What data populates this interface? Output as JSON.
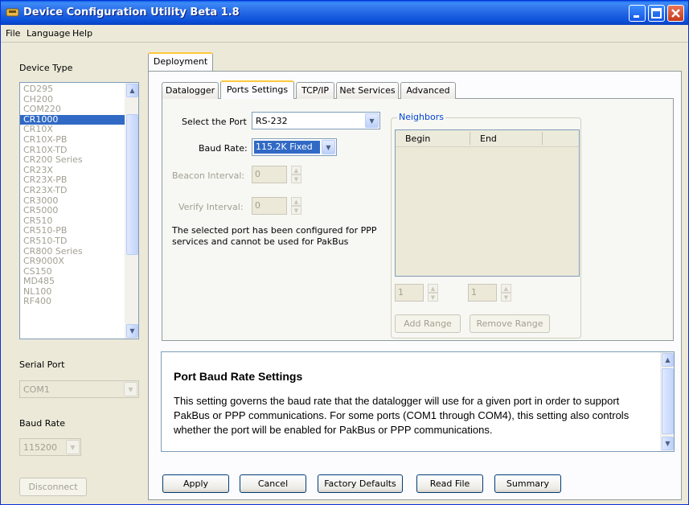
{
  "window": {
    "title": "Device Configuration Utility Beta 1.8"
  },
  "menu": [
    "File",
    "Language",
    "Help"
  ],
  "sidebar": {
    "device_type_label": "Device Type",
    "devices": [
      "CD295",
      "CH200",
      "COM220",
      "CR1000",
      "CR10X",
      "CR10X-PB",
      "CR10X-TD",
      "CR200 Series",
      "CR23X",
      "CR23X-PB",
      "CR23X-TD",
      "CR3000",
      "CR5000",
      "CR510",
      "CR510-PB",
      "CR510-TD",
      "CR800 Series",
      "CR9000X",
      "CS150",
      "MD485",
      "NL100",
      "RF400"
    ],
    "selected_device": "CR1000",
    "serial_port_label": "Serial Port",
    "serial_port_value": "COM1",
    "baud_rate_label": "Baud Rate",
    "baud_rate_value": "115200",
    "disconnect_label": "Disconnect"
  },
  "outer_tabs": [
    "Deployment"
  ],
  "inner_tabs": [
    "Datalogger",
    "Ports Settings",
    "TCP/IP",
    "Net Services",
    "Advanced"
  ],
  "active_inner_tab": "Ports Settings",
  "ports": {
    "select_port_label": "Select the Port",
    "select_port_value": "RS-232",
    "baud_rate_label": "Baud Rate:",
    "baud_rate_value": "115.2K Fixed",
    "beacon_label": "Beacon Interval:",
    "beacon_value": "0",
    "verify_label": "Verify Interval:",
    "verify_value": "0",
    "message": "The selected port has been configured for PPP services and cannot be used for PakBus"
  },
  "neighbors": {
    "title": "Neighbors",
    "col_begin": "Begin",
    "col_end": "End",
    "begin_value": "1",
    "end_value": "1",
    "add_range_label": "Add Range",
    "remove_range_label": "Remove Range"
  },
  "help": {
    "title": "Port Baud Rate Settings",
    "body": "This setting governs the baud rate that the datalogger will use for a given port in order to support PakBus or PPP communications. For some ports (COM1 through COM4), this setting also controls whether the port will be enabled for PakBus or PPP communications."
  },
  "buttons": {
    "apply": "Apply",
    "cancel": "Cancel",
    "factory_defaults": "Factory Defaults",
    "read_file": "Read File",
    "summary": "Summary"
  }
}
